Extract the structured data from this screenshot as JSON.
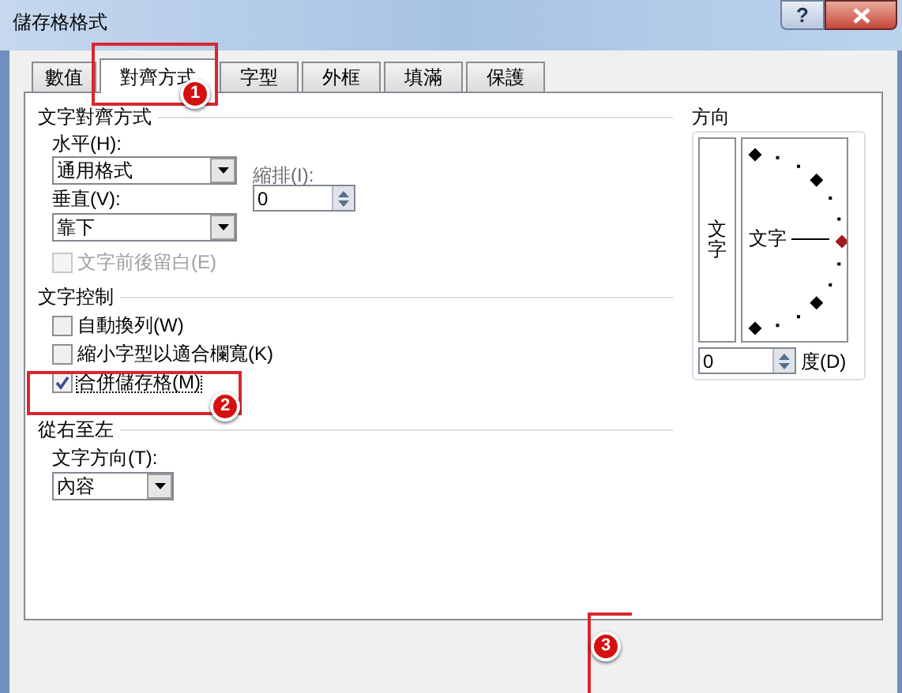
{
  "window": {
    "title": "儲存格格式",
    "help": "?"
  },
  "tabs": [
    {
      "label": "數值",
      "selected": false
    },
    {
      "label": "對齊方式",
      "selected": true
    },
    {
      "label": "字型",
      "selected": false
    },
    {
      "label": "外框",
      "selected": false
    },
    {
      "label": "填滿",
      "selected": false
    },
    {
      "label": "保護",
      "selected": false
    }
  ],
  "alignment": {
    "title": "文字對齊方式",
    "horizontal": {
      "label": "水平(H):",
      "value": "通用格式"
    },
    "indent": {
      "label": "縮排(I):",
      "value": "0"
    },
    "vertical": {
      "label": "垂直(V):",
      "value": "靠下"
    },
    "distributed": {
      "label": "文字前後留白(E)",
      "checked": false,
      "disabled": true
    }
  },
  "text_control": {
    "title": "文字控制",
    "options": [
      {
        "label": "自動換列(W)",
        "checked": false
      },
      {
        "label": "縮小字型以適合欄寬(K)",
        "checked": false
      },
      {
        "label": "合併儲存格(M)",
        "checked": true
      }
    ]
  },
  "right_to_left": {
    "title": "從右至左",
    "direction": {
      "label": "文字方向(T):",
      "value": "內容"
    }
  },
  "orientation": {
    "title": "方向",
    "vertical_text": "文字",
    "dial_text": "文字",
    "degrees": {
      "value": "0",
      "label": "度(D)"
    }
  },
  "annotations": [
    {
      "number": "1"
    },
    {
      "number": "2"
    },
    {
      "number": "3"
    }
  ]
}
